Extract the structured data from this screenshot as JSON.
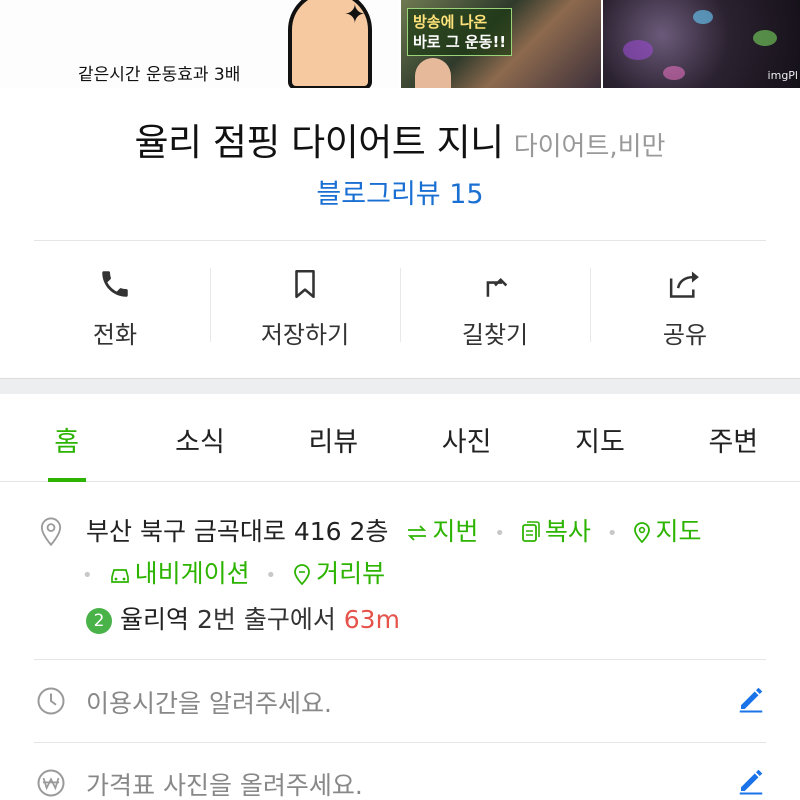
{
  "photos": {
    "photo1_caption": "같은시간 운동효과 3배",
    "photo2_sign_line1": "방송에 나온",
    "photo2_sign_line2": "바로 그 운동!!",
    "photo3_watermark": "imgPl"
  },
  "place": {
    "name": "율리 점핑 다이어트 지니",
    "category": "다이어트,비만",
    "review_label": "블로그리뷰 15"
  },
  "actions": [
    {
      "label": "전화",
      "icon": "phone-icon"
    },
    {
      "label": "저장하기",
      "icon": "bookmark-icon"
    },
    {
      "label": "길찾기",
      "icon": "directions-icon"
    },
    {
      "label": "공유",
      "icon": "share-icon"
    }
  ],
  "tabs": [
    {
      "label": "홈",
      "active": true
    },
    {
      "label": "소식"
    },
    {
      "label": "리뷰"
    },
    {
      "label": "사진"
    },
    {
      "label": "지도"
    },
    {
      "label": "주변"
    }
  ],
  "address": {
    "text": "부산 북구 금곡대로 416 2층",
    "jibun": "지번",
    "copy": "복사",
    "map": "지도",
    "navigation": "내비게이션",
    "streetview": "거리뷰"
  },
  "subway": {
    "line": "2",
    "station": "율리역",
    "exit": "2번 출구에서",
    "distance": "63m",
    "line_color": "#49b34a"
  },
  "hours_prompt": "이용시간을 알려주세요.",
  "price_prompt": "가격표 사진을 올려주세요.",
  "colors": {
    "accent_green": "#2db400",
    "link_blue": "#1a6fd3",
    "edit_blue": "#1a73e8",
    "distance_red": "#e5534b"
  }
}
